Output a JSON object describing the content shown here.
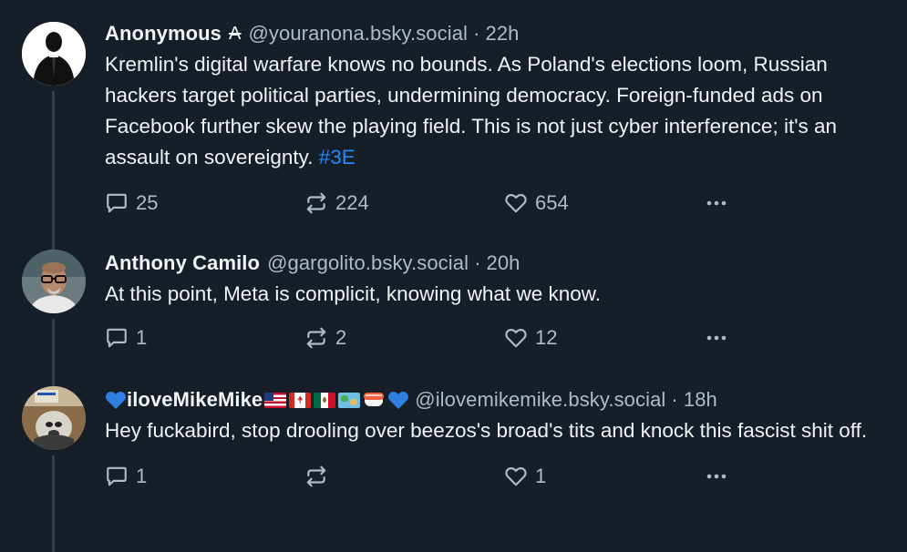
{
  "posts": [
    {
      "display_name": "Anonymous",
      "name_badge": "A",
      "handle": "@youranona.bsky.social",
      "separator": "·",
      "time": "22h",
      "text": "Kremlin's digital warfare knows no bounds. As Poland's elections loom, Russian hackers target political parties, undermining democracy. Foreign-funded ads on Facebook further skew the playing field. This is not just cyber interference; it's an assault on sovereignty.",
      "hashtag": "#3E",
      "replies": "25",
      "reposts": "224",
      "likes": "654",
      "avatar": "anonymous-mask-avatar"
    },
    {
      "display_name": "Anthony Camilo",
      "handle": "@gargolito.bsky.social",
      "separator": "·",
      "time": "20h",
      "text": "At this point, Meta is complicit, knowing what we know.",
      "replies": "1",
      "reposts": "2",
      "likes": "12",
      "avatar": "man-with-glasses-avatar"
    },
    {
      "display_name": "iloveMikeMike",
      "name_emojis": [
        "blue-heart",
        "flag-us",
        "flag-canada",
        "flag-mexico",
        "world-map",
        "sushi",
        "blue-heart"
      ],
      "handle": "@ilovemikemike.bsky.social",
      "separator": "·",
      "time": "18h",
      "text": "Hey fuckabird, stop drooling over beezos's broad's tits and knock this fascist shit off.",
      "replies": "1",
      "reposts": "",
      "likes": "1",
      "avatar": "dog-photo-avatar"
    }
  ],
  "colors": {
    "background": "#161e27",
    "text": "#f1f3f5",
    "muted": "#aebbc9",
    "link": "#208bfe",
    "thread_line": "#2e4052"
  }
}
